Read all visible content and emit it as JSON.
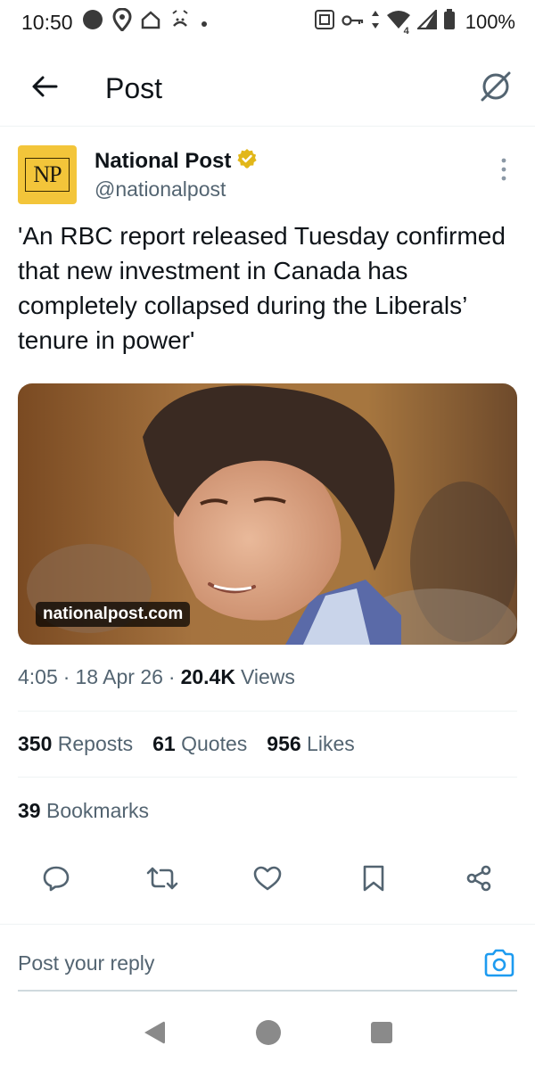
{
  "status_bar": {
    "time": "10:50",
    "battery_text": "100%",
    "network_badge": "4",
    "icons_left": [
      "circle-icon",
      "location-icon",
      "home-icon",
      "alarm-off-icon",
      "dot-icon"
    ],
    "icons_right": [
      "nfc-icon",
      "key-icon",
      "data-arrows-icon",
      "wifi-icon",
      "signal-icon",
      "battery-icon"
    ]
  },
  "header": {
    "title": "Post",
    "back_icon": "arrow-left-icon",
    "grok_icon": "grok-icon"
  },
  "tweet": {
    "avatar_text": "NP",
    "display_name": "National Post",
    "handle": "@nationalpost",
    "verified_color": "#e2b719",
    "text": "'An RBC report released Tuesday confirmed that new investment in Canada has completely collapsed during the Liberals’ tenure in power'",
    "media_label": "nationalpost.com",
    "time": "4:05",
    "date": "18 Apr 26",
    "sep": "·",
    "views_count": "20.4K",
    "views_label": "Views"
  },
  "stats": {
    "reposts_count": "350",
    "reposts_label": "Reposts",
    "quotes_count": "61",
    "quotes_label": "Quotes",
    "likes_count": "956",
    "likes_label": "Likes",
    "bookmarks_count": "39",
    "bookmarks_label": "Bookmarks"
  },
  "actions": [
    "reply-icon",
    "repost-icon",
    "like-icon",
    "bookmark-icon",
    "share-icon"
  ],
  "reply": {
    "placeholder": "Post your reply",
    "accent": "#1d9bf0"
  },
  "nav": [
    "back-triangle-icon",
    "home-circle-icon",
    "recents-square-icon"
  ]
}
